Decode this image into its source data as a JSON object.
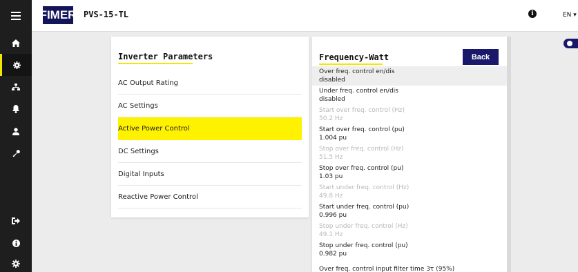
{
  "header": {
    "logo_text": "FIMER",
    "device_title": "PVS-15-TL",
    "language": "EN ▾"
  },
  "sidebar": {
    "items": [
      {
        "icon": "home-icon"
      },
      {
        "icon": "gear-icon",
        "active": true
      },
      {
        "icon": "network-icon"
      },
      {
        "icon": "bell-icon"
      },
      {
        "icon": "user-icon"
      },
      {
        "icon": "wrench-icon"
      }
    ],
    "bottom_items": [
      {
        "icon": "logout-icon"
      },
      {
        "icon": "info-icon"
      },
      {
        "icon": "settings-cog-icon"
      }
    ]
  },
  "left_card": {
    "title": "Inverter Parameters",
    "items": [
      {
        "label": "AC Output Rating"
      },
      {
        "label": "AC Settings"
      },
      {
        "label": "Active Power Control"
      },
      {
        "label": "DC Settings"
      },
      {
        "label": "Digital Inputs"
      },
      {
        "label": "Reactive Power Control"
      }
    ]
  },
  "right_card": {
    "title": "Frequency-Watt",
    "back_label": "Back",
    "params": [
      {
        "label": "Over freq. control en/dis",
        "value": "disabled"
      },
      {
        "label": "Under freq. control en/dis",
        "value": "disabled"
      },
      {
        "label": "Start over freq. control (Hz)",
        "value": "50.2 Hz"
      },
      {
        "label": "Start over freq. control (pu)",
        "value": "1.004 pu"
      },
      {
        "label": "Stop over freq. control (Hz)",
        "value": "51.5 Hz"
      },
      {
        "label": "Stop over freq. control (pu)",
        "value": "1.03 pu"
      },
      {
        "label": "Start under freq. control (Hz)",
        "value": "49.8 Hz"
      },
      {
        "label": "Start under freq. control (pu)",
        "value": "0.996 pu"
      },
      {
        "label": "Stop under freq. control (Hz)",
        "value": "49.1 Hz"
      },
      {
        "label": "Stop under freq. control (pu)",
        "value": "0.982 pu"
      },
      {
        "label": "Over freq. control input filter time 3τ (95%)",
        "value": ""
      }
    ]
  },
  "colors": {
    "accent_yellow": "#fff200",
    "brand_navy": "#19186a",
    "sidebar_dark": "#1e1e1e",
    "disabled_text": "#b8b8b8"
  }
}
